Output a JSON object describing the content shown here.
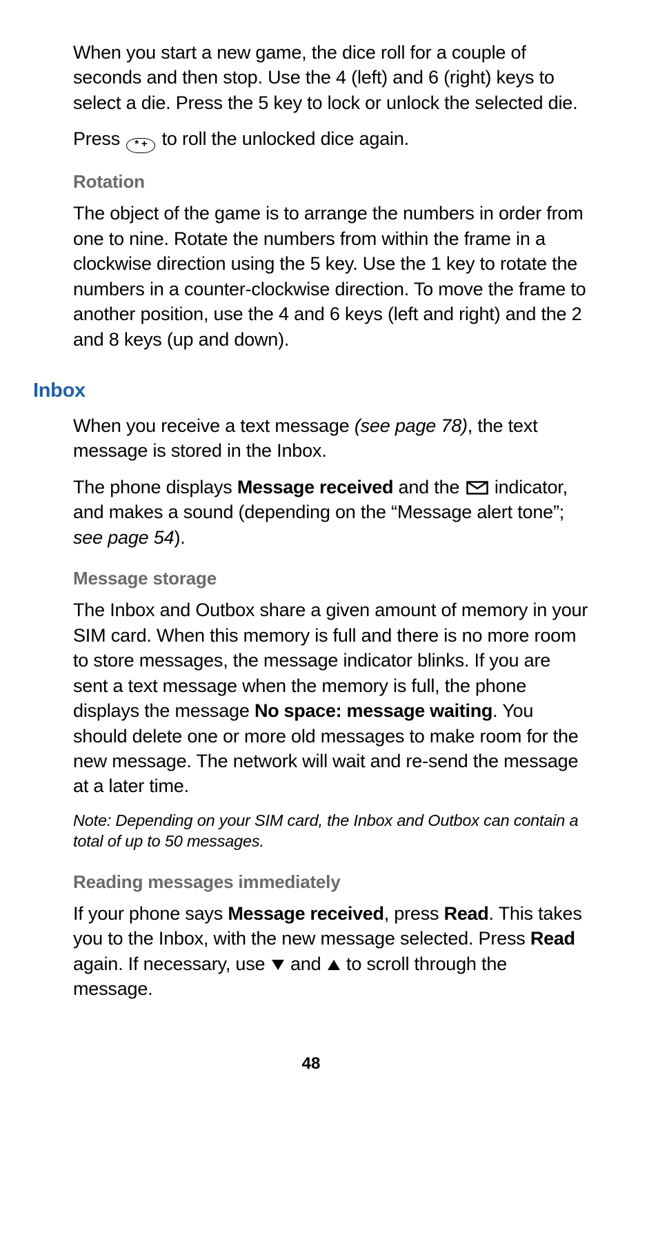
{
  "intro": {
    "dice_para": "When you start a new game, the dice roll for a couple of seconds and then stop. Use the 4 (left) and 6 (right) keys to select a die. Press the 5 key to lock or unlock the selected die.",
    "press_prefix": "Press ",
    "key_label": "* +",
    "press_suffix": " to roll the unlocked dice again."
  },
  "rotation": {
    "heading": "Rotation",
    "para": "The object of the game is to arrange the numbers in order from one to nine. Rotate the numbers from within the frame in a clockwise direction using the 5 key. Use the 1 key to rotate the numbers in a counter-clockwise direction. To move the frame to another position, use the 4 and 6 keys (left and right) and the 2 and 8 keys (up and down)."
  },
  "inbox": {
    "heading": "Inbox",
    "p1_a": "When you receive a text message ",
    "p1_ref": "(see page 78)",
    "p1_b": ", the text message is stored in the Inbox.",
    "p2_a": "The phone displays ",
    "p2_bold1": "Message received",
    "p2_b": " and the ",
    "p2_c": " indicator, and makes a sound (depending on the “Message alert tone”; ",
    "p2_ref": "see page 54",
    "p2_d": ")."
  },
  "storage": {
    "heading": "Message storage",
    "p1_a": "The Inbox and Outbox share a given amount of memory in your SIM card. When this memory is full and there is no more room to store messages, the message indicator blinks. If you are sent a text message when the memory is full, the phone displays the message ",
    "p1_bold": "No space: message waiting",
    "p1_b": ". You should delete one or more old messages to make room for the new message. The network will wait and re-send the message at a later time.",
    "note": "Note: Depending on your SIM card, the Inbox and Outbox can contain a total of up to 50 messages."
  },
  "reading": {
    "heading": "Reading messages immediately",
    "p1_a": "If your phone says ",
    "p1_bold1": "Message received",
    "p1_b": ", press ",
    "p1_bold2": "Read",
    "p1_c": ". This takes you to the Inbox, with the new message selected. Press ",
    "p1_bold3": "Read",
    "p1_d": " again. If necessary, use ",
    "p1_e": " and ",
    "p1_f": " to scroll through the message."
  },
  "page_number": "48"
}
